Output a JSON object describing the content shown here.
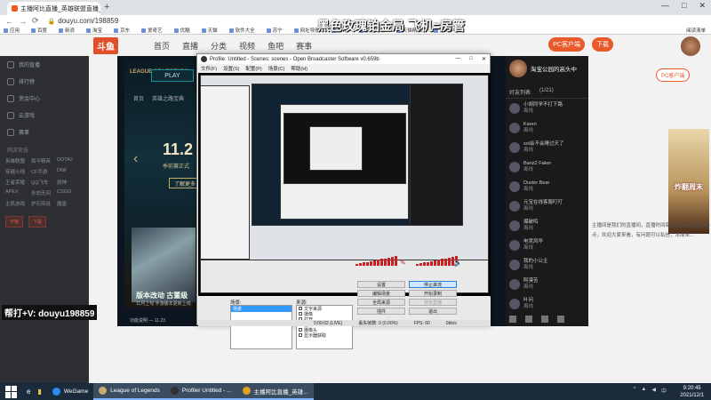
{
  "browser": {
    "tab_title": "主播阿比直播_英雄联盟直播_斗...",
    "url": "douyu.com/198859",
    "bookmarks": [
      "应用",
      "百度",
      "新浪",
      "淘宝",
      "京东",
      "爱奇艺",
      "优酷",
      "天猫",
      "软件大全",
      "苏宁",
      "网址导航",
      "腾讯",
      "京东商城",
      "天猫精品",
      "游戏中心"
    ],
    "bookmarks_right": "阅读清单"
  },
  "overlay_title": "黑色玫瑰铂金局 飞机=房管",
  "help_text": "帮打+V: douyu198859",
  "site": {
    "logo": "斗鱼",
    "nav": [
      "首页",
      "直播",
      "分类",
      "视频",
      "鱼吧",
      "赛事"
    ],
    "header_buttons": [
      "PC客户端",
      "下载"
    ],
    "sidebar_items": [
      "我的直播",
      "排行榜",
      "赏金中心",
      "云游戏",
      "赛事"
    ],
    "sidebar_section": "网游竞技",
    "sidebar_grid": [
      "英雄联盟",
      "和平精英",
      "DOTA2",
      "穿越火线",
      "CF手游",
      "DNF",
      "王者荣耀",
      "QQ飞车",
      "原神",
      "APEX",
      "永劫无间",
      "CSGO",
      "主机游戏",
      "炉石传说",
      "魔兽"
    ],
    "sidebar_buttons": [
      "开播",
      "下载"
    ],
    "pc_button": "PC客户端",
    "promo_text": "炸翻周末",
    "description": "主播间是我们的直播间，直播时间每天晚上8点到凌晨3点，欢迎大家来看，有问题可以私信，本周末..."
  },
  "game": {
    "logo": "LEAGUE OF LEGENDS",
    "play": "PLAY",
    "nav": [
      "首页",
      "英雄之路宝典"
    ],
    "big_text": "11.2",
    "subtitle": "季前赛正式",
    "learn": "了解更多",
    "patch": "版本改动 古董级",
    "patch_sub": "11月上旬 手游版本更新上线",
    "patch_date": "功能说明 — 11.23"
  },
  "room": {
    "streamer": "淘宝公园的高头中",
    "tabs": [
      "好友列表",
      "(1/21)"
    ],
    "viewers": [
      {
        "name": "小胡同学不打下路",
        "sub": "离线"
      },
      {
        "name": "Karen",
        "sub": "离线"
      },
      {
        "name": "sol会不会睡过天了",
        "sub": "离线"
      },
      {
        "name": "Banz2 Faker",
        "sub": "离线"
      },
      {
        "name": "Duster Bear",
        "sub": "离线"
      },
      {
        "name": "元宝在线客服叮叮",
        "sub": "离线"
      },
      {
        "name": "爆破鸣",
        "sub": "离线"
      },
      {
        "name": "电竞风华",
        "sub": "离线"
      },
      {
        "name": "我的小公主",
        "sub": "离线"
      },
      {
        "name": "阿漠苦",
        "sub": "离线"
      },
      {
        "name": "叶问",
        "sub": "离线"
      }
    ]
  },
  "obs": {
    "title": "Profile: Untitled - Scenes: scenes - Open Broadcaster Software v0.659b",
    "menu": [
      "文件(F)",
      "设置(S)",
      "配置(P)",
      "场景(C)",
      "帮助(H)"
    ],
    "scenes_label": "场景:",
    "scene_selected": "场景",
    "sources_label": "来源:",
    "sources": [
      "文字来源",
      "摄像",
      "打开",
      "窗口",
      "摄像头",
      "显示器获取"
    ],
    "buttons": [
      "设置",
      "编辑场景",
      "全局来源",
      "插件",
      "停止串流",
      "开始录制",
      "预览直播",
      "退出"
    ],
    "status": [
      "0:00:02 (LIVE)",
      "丢失帧数: 0 (0.00%)",
      "FPS: 60",
      "0kb/s"
    ]
  },
  "taskbar": {
    "apps": [
      "WeGame",
      "League of Legends",
      "Profiler Untitled - ...",
      "主播阿比直播_英雄..."
    ],
    "time": "9:20:45",
    "date": "2021/12/1"
  }
}
